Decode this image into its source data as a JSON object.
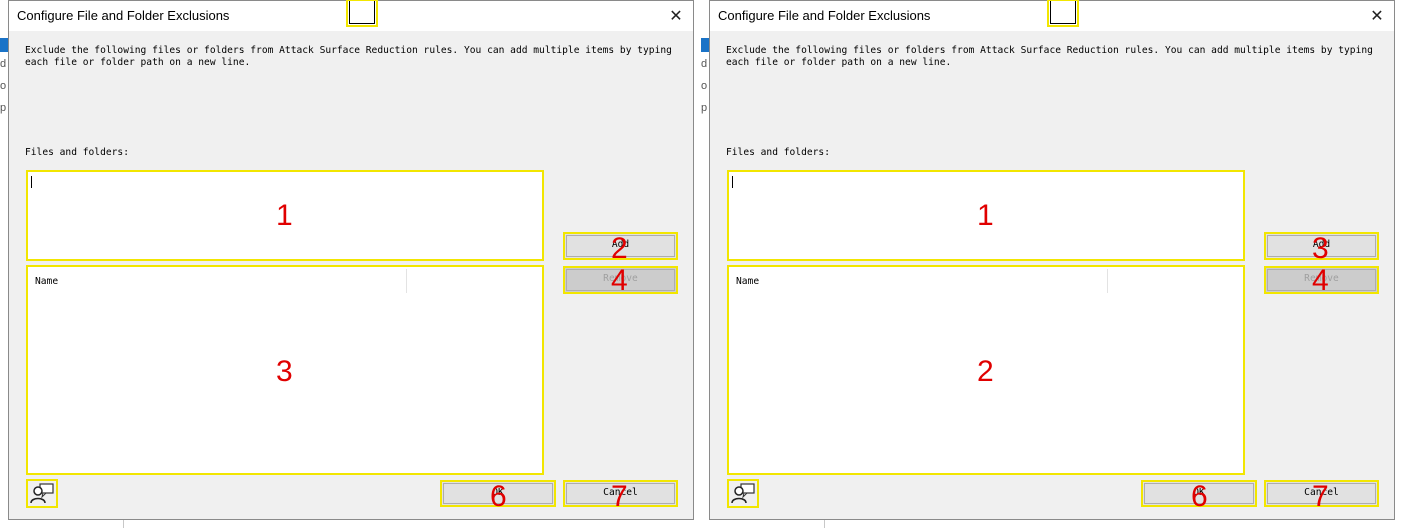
{
  "left_edge_glyphs": [
    "d",
    "o",
    "p"
  ],
  "dialogs": [
    {
      "title": "Configure File and Folder Exclusions",
      "close_symbol": "✕",
      "description": "Exclude the following files or folders from Attack Surface Reduction rules. You can add multiple items by typing each file or folder path on a new line.",
      "files_label": "Files and folders:",
      "path_input_value": "",
      "list_column_name": "Name",
      "buttons": {
        "add": "Add",
        "remove": "Remove",
        "ok": "OK",
        "cancel": "Cancel"
      },
      "remove_disabled": true,
      "user_icon": "user-comment-icon",
      "markers": {
        "path_input": "1",
        "add": "2",
        "list": "3",
        "remove": "4",
        "ok": "6",
        "cancel": "7"
      }
    },
    {
      "title": "Configure File and Folder Exclusions",
      "close_symbol": "✕",
      "description": "Exclude the following files or folders from Attack Surface Reduction rules. You can add multiple items by typing each file or folder path on a new line.",
      "files_label": "Files and folders:",
      "path_input_value": "",
      "list_column_name": "Name",
      "buttons": {
        "add": "Add",
        "remove": "Remove",
        "ok": "OK",
        "cancel": "Cancel"
      },
      "remove_disabled": true,
      "user_icon": "user-comment-icon",
      "markers": {
        "path_input": "1",
        "add": "3",
        "list": "2",
        "remove": "4",
        "ok": "6",
        "cancel": "7"
      }
    }
  ],
  "colors": {
    "highlight": "#f2e600",
    "marker": "#e00000",
    "dialog_bg": "#f0f0f0",
    "accent_blue": "#1a73c7"
  }
}
